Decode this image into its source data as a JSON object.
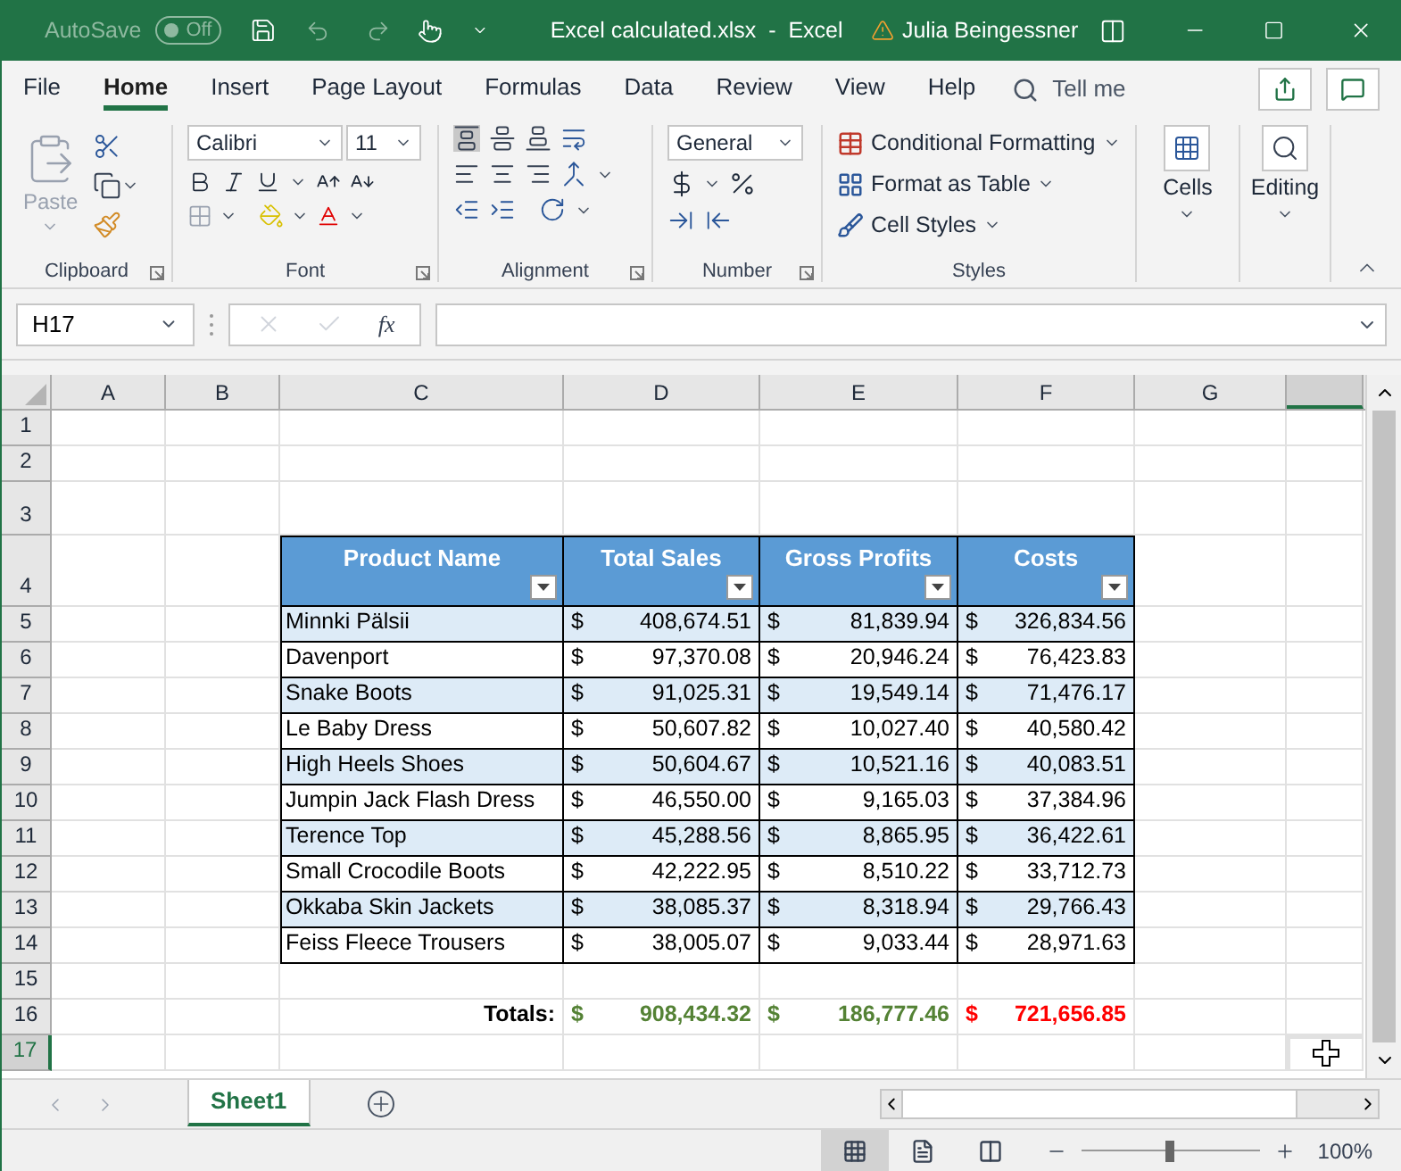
{
  "title_bar": {
    "autosave_label": "AutoSave",
    "autosave": {
      "label": "Off",
      "on": false
    },
    "title": "Excel calculated.xlsx  -  Excel",
    "user": "Julia Beingessner"
  },
  "tabs": [
    {
      "label": "File",
      "selected": false
    },
    {
      "label": "Home",
      "selected": true
    },
    {
      "label": "Insert",
      "selected": false
    },
    {
      "label": "Page Layout",
      "selected": false
    },
    {
      "label": "Formulas",
      "selected": false
    },
    {
      "label": "Data",
      "selected": false
    },
    {
      "label": "Review",
      "selected": false
    },
    {
      "label": "View",
      "selected": false
    },
    {
      "label": "Help",
      "selected": false
    }
  ],
  "tell_me": {
    "placeholder": "Tell me"
  },
  "ribbon": {
    "clipboard": {
      "paste": "Paste",
      "label": "Clipboard"
    },
    "font": {
      "font": "Calibri",
      "size": "11",
      "label": "Font"
    },
    "alignment": {
      "label": "Alignment"
    },
    "number": {
      "format": "General",
      "label": "Number"
    },
    "styles": {
      "items": [
        "Conditional Formatting",
        "Format as Table",
        "Cell Styles"
      ],
      "label": "Styles"
    },
    "cells": {
      "label": "Cells"
    },
    "editing": {
      "label": "Editing"
    }
  },
  "formula_bar": {
    "name_box": "H17",
    "function_label": "fx"
  },
  "columns": [
    {
      "label": "A",
      "selected": false
    },
    {
      "label": "B",
      "selected": false
    },
    {
      "label": "C",
      "selected": false
    },
    {
      "label": "D",
      "selected": false
    },
    {
      "label": "E",
      "selected": false
    },
    {
      "label": "F",
      "selected": false
    },
    {
      "label": "G",
      "selected": false
    },
    {
      "selected": true
    }
  ],
  "rows": [
    {
      "label": "1",
      "selected": false
    },
    {
      "label": "2",
      "selected": false
    },
    {
      "label": "3",
      "selected": false
    },
    {
      "label": "4",
      "selected": false
    },
    {
      "label": "5",
      "selected": false
    },
    {
      "label": "6",
      "selected": false
    },
    {
      "label": "7",
      "selected": false
    },
    {
      "label": "8",
      "selected": false
    },
    {
      "label": "9",
      "selected": false
    },
    {
      "label": "10",
      "selected": false
    },
    {
      "label": "11",
      "selected": false
    },
    {
      "label": "12",
      "selected": false
    },
    {
      "label": "13",
      "selected": false
    },
    {
      "label": "14",
      "selected": false
    },
    {
      "label": "15",
      "selected": false
    },
    {
      "label": "16",
      "selected": false
    },
    {
      "label": "17",
      "selected": true
    }
  ],
  "table": {
    "headers": [
      "Product Name",
      "Total Sales",
      "Gross Profits",
      "Costs"
    ],
    "currency": "$",
    "rows": [
      {
        "name": "Minnki Pälsii",
        "sales": "408,674.51",
        "profits": "81,839.94",
        "costs": "326,834.56"
      },
      {
        "name": "Davenport",
        "sales": "97,370.08",
        "profits": "20,946.24",
        "costs": "76,423.83"
      },
      {
        "name": "Snake Boots",
        "sales": "91,025.31",
        "profits": "19,549.14",
        "costs": "71,476.17"
      },
      {
        "name": "Le Baby Dress",
        "sales": "50,607.82",
        "profits": "10,027.40",
        "costs": "40,580.42"
      },
      {
        "name": "High Heels Shoes",
        "sales": "50,604.67",
        "profits": "10,521.16",
        "costs": "40,083.51"
      },
      {
        "name": "Jumpin Jack Flash Dress",
        "sales": "46,550.00",
        "profits": "9,165.03",
        "costs": "37,384.96"
      },
      {
        "name": "Terence Top",
        "sales": "45,288.56",
        "profits": "8,865.95",
        "costs": "36,422.61"
      },
      {
        "name": "Small Crocodile Boots",
        "sales": "42,222.95",
        "profits": "8,510.22",
        "costs": "33,712.73"
      },
      {
        "name": "Okkaba Skin Jackets",
        "sales": "38,085.37",
        "profits": "8,318.94",
        "costs": "29,766.43"
      },
      {
        "name": "Feiss Fleece Trousers",
        "sales": "38,005.07",
        "profits": "9,033.44",
        "costs": "28,971.63"
      }
    ],
    "totals_label": "Totals:",
    "totals": [
      {
        "currency": "$",
        "value": "908,434.32",
        "color": "#548235"
      },
      {
        "currency": "$",
        "value": "186,777.46",
        "color": "#548235"
      },
      {
        "currency": "$",
        "value": "721,656.85",
        "color": "#ff0000"
      }
    ]
  },
  "sheet_tabs": [
    {
      "label": "Sheet1",
      "selected": true
    }
  ],
  "status_bar": {
    "views": [
      {
        "kind": "normal",
        "selected": true
      },
      {
        "kind": "page-layout",
        "selected": false
      },
      {
        "kind": "page-break",
        "selected": false
      }
    ],
    "zoom": {
      "level": 0.5,
      "reading": "100%"
    }
  }
}
